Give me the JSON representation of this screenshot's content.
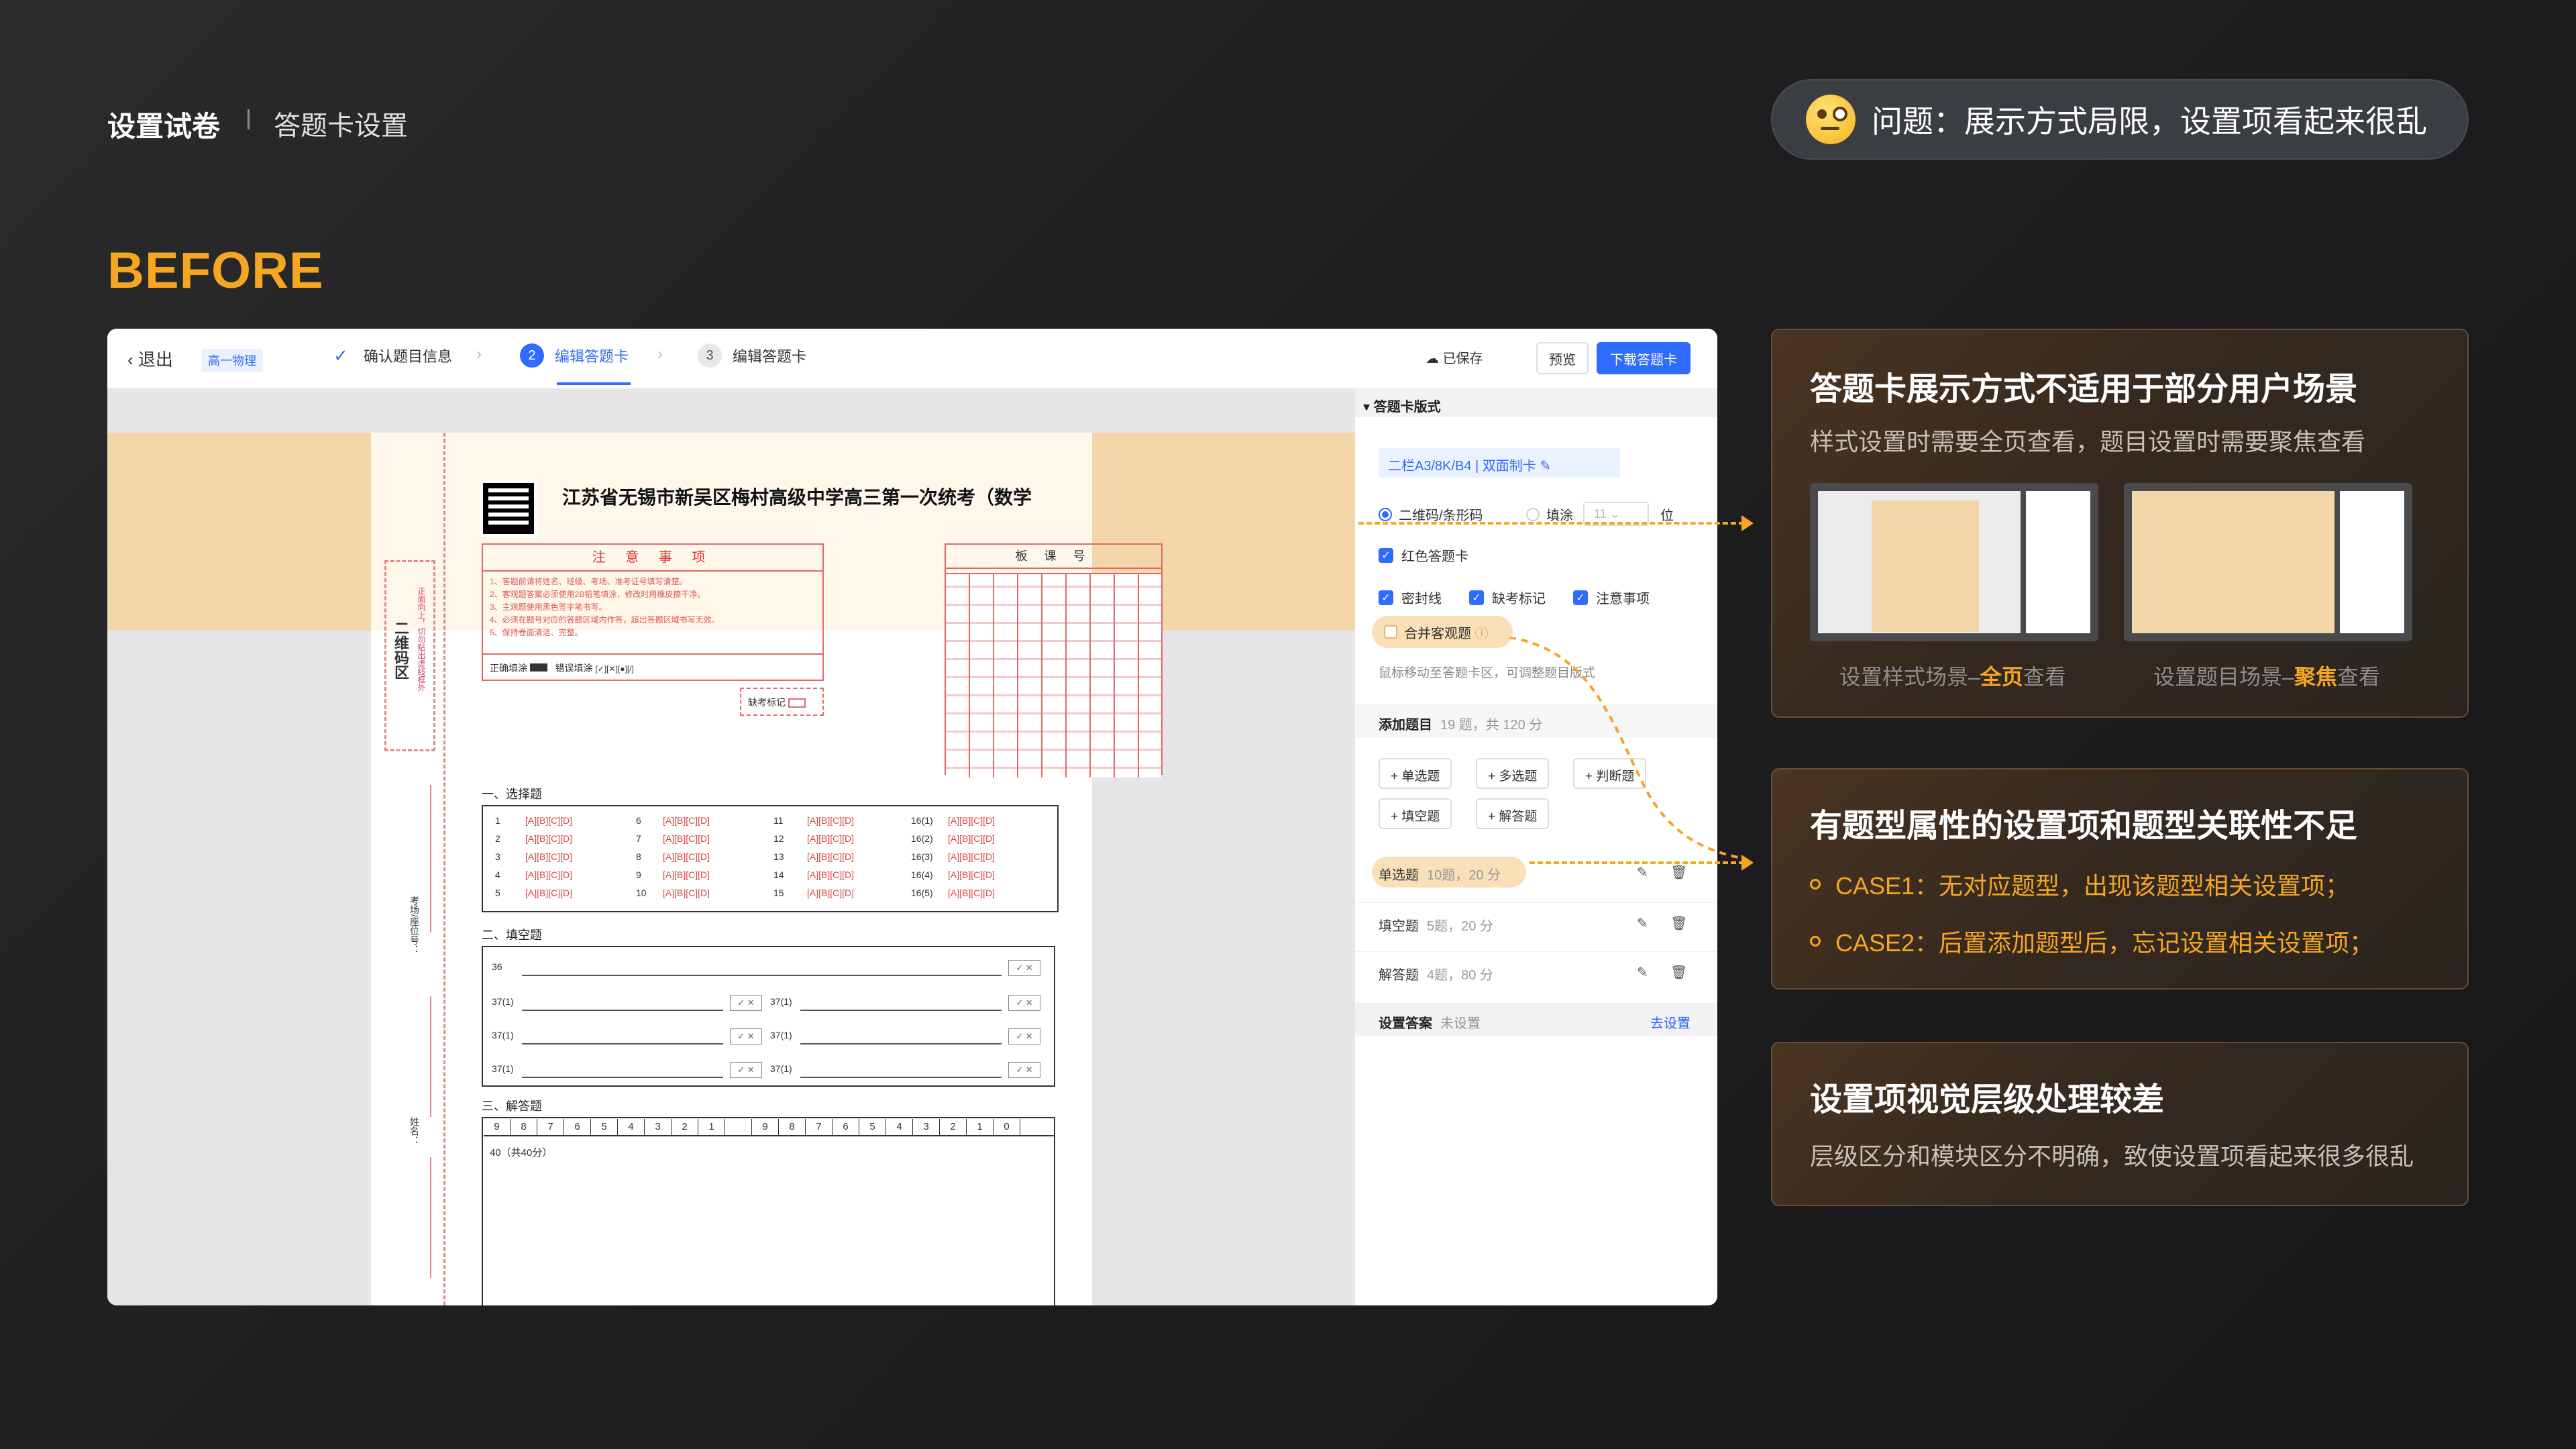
{
  "header": {
    "title": "设置试卷",
    "subtitle": "答题卡设置"
  },
  "problem": {
    "text": "问题：展示方式局限，设置项看起来很乱",
    "icon": "thinking-face-icon"
  },
  "section_label": "BEFORE",
  "topbar": {
    "exit": "退出",
    "badge": "高一物理",
    "steps": [
      {
        "num": "✓",
        "label": "确认题目信息"
      },
      {
        "num": "2",
        "label": "编辑答题卡"
      },
      {
        "num": "3",
        "label": "编辑答题卡"
      }
    ],
    "saved": "已保存",
    "preview": "预览",
    "download": "下载答题卡"
  },
  "paper": {
    "title": "江苏省无锡市新吴区梅村高级中学高三第一次统考（数学",
    "qr_zone_title": "二维码区",
    "qr_zone_sub": "正面向上，切勿贴出虚线框外",
    "vlabel_1": "考场/座位号：",
    "vlabel_2": "姓名：",
    "notice_title": "注 意 事 项",
    "notice_items": [
      "1、答题前请将姓名、班级、考场、准考证号填写清楚。",
      "2、客观题答案必须使用2B铅笔填涂，修改时用橡皮擦干净。",
      "3、主观题使用黑色签字笔书写。",
      "4、必须在题号对应的答题区域内作答，超出答题区域书写无效。",
      "5、保持卷面清洁、完整。"
    ],
    "fill_correct": "正确填涂",
    "fill_wrong": "错误填涂",
    "absent_label": "缺考标记",
    "omr_title": "板 课 号",
    "sec1": "一、选择题",
    "sec2": "二、填空题",
    "sec3": "三、解答题",
    "mc_rows": [
      [
        "1",
        "[A][B][C][D]",
        "6",
        "[A][B][C][D]",
        "11",
        "[A][B][C][D]",
        "16(1)",
        "[A][B][C][D]"
      ],
      [
        "2",
        "[A][B][C][D]",
        "7",
        "[A][B][C][D]",
        "12",
        "[A][B][C][D]",
        "16(2)",
        "[A][B][C][D]"
      ],
      [
        "3",
        "[A][B][C][D]",
        "8",
        "[A][B][C][D]",
        "13",
        "[A][B][C][D]",
        "16(3)",
        "[A][B][C][D]"
      ],
      [
        "4",
        "[A][B][C][D]",
        "9",
        "[A][B][C][D]",
        "14",
        "[A][B][C][D]",
        "16(4)",
        "[A][B][C][D]"
      ],
      [
        "5",
        "[A][B][C][D]",
        "10",
        "[A][B][C][D]",
        "15",
        "[A][B][C][D]",
        "16(5)",
        "[A][B][C][D]"
      ]
    ],
    "fb_labels": [
      "36",
      "37(1)",
      "37(1)",
      "37(1)",
      "37(1)",
      "37(1)",
      "37(1)"
    ],
    "score_digits": [
      "9",
      "8",
      "7",
      "6",
      "5",
      "4",
      "3",
      "2",
      "1",
      "",
      "9",
      "8",
      "7",
      "6",
      "5",
      "4",
      "3",
      "2",
      "1",
      "0"
    ],
    "essay_label": "40（共40分）"
  },
  "panel": {
    "header": "答题卡版式",
    "layout": "二栏A3/8K/B4 | 双面制卡",
    "radio_qr": "二维码/条形码",
    "radio_fill": "填涂",
    "fill_count": "11",
    "fill_unit": "位",
    "chk_red": "红色答题卡",
    "chk_seal": "密封线",
    "chk_absent": "缺考标记",
    "chk_notice": "注意事项",
    "merge": "合并客观题",
    "hint": "鼠标移动至答题卡区，可调整题目版式",
    "addq": "添加题目",
    "addq_stat": "19 题，共 120 分",
    "add_buttons": [
      "+ 单选题",
      "+ 多选题",
      "+ 判断题",
      "+ 填空题",
      "+ 解答题"
    ],
    "qtypes": [
      {
        "name": "单选题",
        "stat": "10题，20 分"
      },
      {
        "name": "填空题",
        "stat": "5题，20 分"
      },
      {
        "name": "解答题",
        "stat": "4题，80 分"
      }
    ],
    "answer": "设置答案",
    "answer_status": "未设置",
    "answer_link": "去设置"
  },
  "cards": [
    {
      "title": "答题卡展示方式不适用于部分用户场景",
      "desc": "样式设置时需要全页查看，题目设置时需要聚焦查看",
      "cap1_pre": "设置样式场景–",
      "cap1_hl": "全页",
      "cap1_post": "查看",
      "cap2_pre": "设置题目场景–",
      "cap2_hl": "聚焦",
      "cap2_post": "查看"
    },
    {
      "title": "有题型属性的设置项和题型关联性不足",
      "case1": "CASE1：无对应题型，出现该题型相关设置项；",
      "case2": "CASE2：后置添加题型后，忘记设置相关设置项；"
    },
    {
      "title": "设置项视觉层级处理较差",
      "desc": "层级区分和模块区分不明确，致使设置项看起来很多很乱"
    }
  ],
  "colors": {
    "accent": "#f5a623",
    "primary_blue": "#2f6bff",
    "sheet_red": "#e06a6a",
    "highlight": "#f9e0b8"
  }
}
